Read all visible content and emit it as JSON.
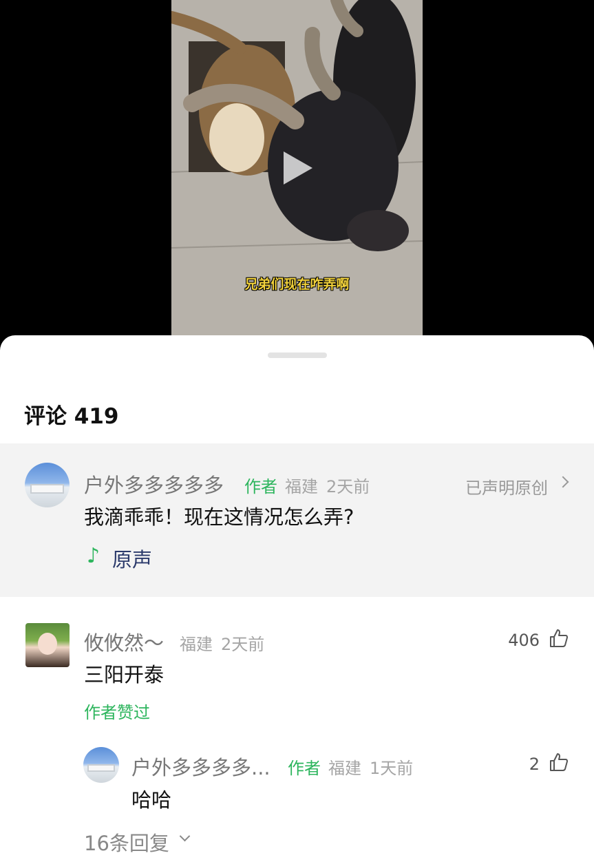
{
  "video": {
    "subtitle": "兄弟们现在咋弄啊"
  },
  "comments_header": {
    "label": "评论 419"
  },
  "pinned_comment": {
    "author": "户外多多多多多",
    "author_tag": "作者",
    "location": "福建",
    "time": "2天前",
    "original_link": "已声明原创",
    "text": "我滴乖乖！现在这情况怎么弄?",
    "music_label": "原声"
  },
  "comments": [
    {
      "author": "攸攸然～",
      "location": "福建",
      "time": "2天前",
      "text": "三阳开泰",
      "likes": "406",
      "author_liked": "作者赞过",
      "reply": {
        "author": "户外多多多多...",
        "author_tag": "作者",
        "location": "福建",
        "time": "1天前",
        "text": "哈哈",
        "likes": "2"
      },
      "replies_link": "16条回复"
    }
  ],
  "colors": {
    "accent_green": "#2db55d",
    "music_text": "#2b3a6b",
    "pinned_bg": "#f3f3f3"
  },
  "icons": [
    "play-icon",
    "chevron-right-icon",
    "music-note-icon",
    "thumbs-up-icon",
    "chevron-down-icon"
  ]
}
